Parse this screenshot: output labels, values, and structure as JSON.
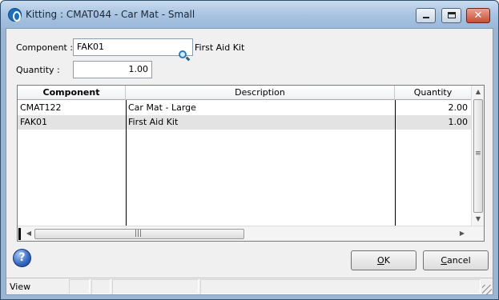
{
  "window": {
    "title": "Kitting : CMAT044 - Car Mat - Small",
    "minimize": "minimize",
    "maximize": "maximize",
    "close_glyph": "✕"
  },
  "form": {
    "component_label": "Component :",
    "component_value": "FAK01",
    "component_description": "First Aid Kit",
    "quantity_label": "Quantity :",
    "quantity_value": "1.00"
  },
  "grid": {
    "columns": [
      "Component",
      "Description",
      "Quantity"
    ],
    "rows": [
      {
        "component": "CMAT122",
        "description": "Car Mat - Large",
        "quantity": "2.00"
      },
      {
        "component": "FAK01",
        "description": "First Aid Kit",
        "quantity": "1.00"
      }
    ]
  },
  "buttons": {
    "help": "?",
    "ok_mnemonic": "O",
    "ok_rest": "K",
    "cancel_mnemonic": "C",
    "cancel_rest": "ancel"
  },
  "status_bar": {
    "text": "View"
  },
  "icons": {
    "app": "app-logo-icon",
    "lookup": "magnifier-icon",
    "help": "help-icon"
  },
  "colors": {
    "titlebar": "#a9c4e2",
    "selected_row": "#e3e3e3",
    "close_button": "#c94c35"
  }
}
